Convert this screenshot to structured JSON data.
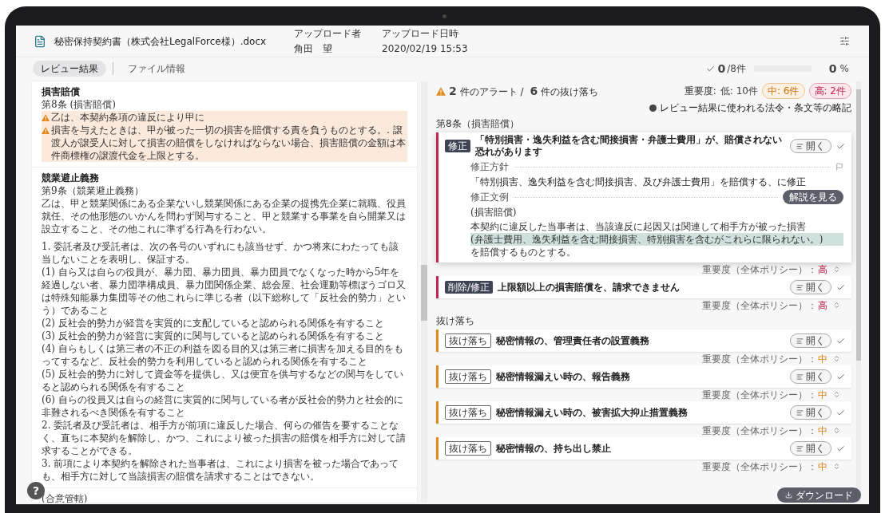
{
  "file": {
    "name": "秘密保持契約書（株式会社LegalForce様）.docx",
    "uploader_label": "アップロード者",
    "uploader": "角田　望",
    "date_label": "アップロード日時",
    "date": "2020/02/19 15:53"
  },
  "tabs": [
    {
      "label": "レビュー結果",
      "selected": true
    },
    {
      "label": "ファイル情報",
      "selected": false
    }
  ],
  "progress": {
    "done": "0",
    "total": "/8件",
    "level": 0,
    "percent": "0",
    "percent_unit": "%"
  },
  "document": {
    "sections": [
      {
        "title": "損害賠償",
        "article": "第8条 (損害賠償)",
        "paragraphs": [
          {
            "kind": "alert",
            "segments": [
              {
                "text": "乙は、本契約条項の違反により甲に"
              },
              {
                "text": "損害を与えたときは、甲が被った一切の損害を賠償する責を負うものとする。. 譲渡人が譲受人に対して損害の賠償をしなければならない場合、損害賠償の金額は本件商標権の譲渡代金を上限とする。"
              }
            ]
          }
        ]
      },
      {
        "title": "競業避止義務",
        "article": "第9条（競業避止義務）",
        "paragraphs": [
          {
            "kind": "plain",
            "text": "乙は、甲と競業関係にある企業ないし競業関係にある企業の提携先企業に就職、役員就任、その他形態のいかんを問わず関与すること、甲と競業する事業を自ら開業又は設立すること、その他これに準ずる行為を行わない。"
          },
          {
            "kind": "gap"
          },
          {
            "kind": "plain",
            "text": "1. 委託者及び受託者は、次の各号のいずれにも該当せず、かつ将来にわたっても該当しないことを表明し、保証する。"
          },
          {
            "kind": "plain",
            "text": "(1) 自ら又は自らの役員が、暴力団、暴力団員、暴力団員でなくなった時から5年を経過しない者、暴力団準構成員、暴力団関係企業、総会屋、社会運動等標ぼうゴロ又は特殊知能暴力集団等その他これらに準じる者（以下総称して「反社会的勢力」という）であること"
          },
          {
            "kind": "plain",
            "text": "(2) 反社会的勢力が経営を実質的に支配していると認められる関係を有すること"
          },
          {
            "kind": "plain",
            "text": "(3) 反社会的勢力が経営に実質的に関与していると認められる関係を有すること"
          },
          {
            "kind": "plain",
            "text": "(4) 自らもしくは第三者の不正の利益を図る目的又は第三者に損害を加える目的をもってするなど、反社会的勢力を利用していると認められる関係を有すること"
          },
          {
            "kind": "plain",
            "text": "(5) 反社会的勢力に対して資金等を提供し、又は便宜を供与するなどの関与をしていると認められる関係を有すること"
          },
          {
            "kind": "plain",
            "text": "(6) 自らの役員又は自らの経営に実質的に関与している者が反社会的勢力と社会的に非難されるべき関係を有すること"
          },
          {
            "kind": "plain",
            "text": "2. 委託者及び受託者は、相手方が前項に違反した場合、何らの催告を要することなく、直ちに本契約を解除し、かつ、これにより被った損害の賠償を相手方に対して請求することができる。"
          },
          {
            "kind": "plain",
            "text": "3. 前項により本契約を解除された当事者は、これにより損害を被った場合であっても、相手方に対して当該損害の賠償を請求することはできない。"
          }
        ]
      },
      {
        "article": "(合意管轄)"
      }
    ]
  },
  "review": {
    "summary": {
      "alerts": "2",
      "alerts_label": "件のアラート /",
      "omissions": "6",
      "omissions_label": "件の抜け落ち"
    },
    "severity": {
      "label": "重要度:",
      "low": "低: 10件",
      "medium": "中: 6件",
      "high": "高: 2件"
    },
    "notes_link": "レビュー結果に使われる法令・条文等の略記",
    "groups": [
      {
        "title": "第8条（損害賠償）",
        "items": [
          {
            "kind": "alert",
            "tag": "修正",
            "title": "「特別損害・逸失利益を含む間接損害・弁護士費用」が、賠償されない恐れがあります",
            "open": "開く",
            "expanded": true,
            "detail": {
              "policy_label": "修正方針",
              "policy": "「特別損害、逸失利益を含む間接損害、及び弁護士費用」を賠償する、に修正",
              "example_label": "修正文例",
              "explain_button": "解説を見る",
              "example_title": "(損害賠償)",
              "example_segments": [
                {
                  "text": "本契約に違反した当事者は、当該違反に起因又は関連して相手方が被った損害",
                  "highlighted": false
                },
                {
                  "text": "(弁護士費用、逸失利益を含む間接損害、特別損害を含むがこれらに限られない。)",
                  "highlighted": true
                },
                {
                  "text": "を賠償するものとする。",
                  "highlighted": false
                }
              ]
            },
            "severity": {
              "label": "重要度（全体ポリシー）：",
              "value": "高",
              "kind": "high"
            }
          },
          {
            "kind": "alert",
            "tag": "削除/修正",
            "title": "上限額以上の損害賠償を、請求できません",
            "open": "開く",
            "expanded": false,
            "severity": {
              "label": "重要度（全体ポリシー）：",
              "value": "高",
              "kind": "high"
            }
          }
        ]
      },
      {
        "title": "抜け落ち",
        "items": [
          {
            "kind": "omission",
            "tag": "抜け落ち",
            "title": "秘密情報の、管理責任者の設置義務",
            "open": "開く",
            "expanded": false,
            "severity": {
              "label": "重要度（全体ポリシー）：",
              "value": "中",
              "kind": "medium"
            }
          },
          {
            "kind": "omission",
            "tag": "抜け落ち",
            "title": "秘密情報漏えい時の、報告義務",
            "open": "開く",
            "expanded": false,
            "severity": {
              "label": "重要度（全体ポリシー）：",
              "value": "中",
              "kind": "medium"
            }
          },
          {
            "kind": "omission",
            "tag": "抜け落ち",
            "title": "秘密情報漏えい時の、被害拡大抑止措置義務",
            "open": "開く",
            "expanded": false,
            "severity": {
              "label": "重要度（全体ポリシー）：",
              "value": "中",
              "kind": "medium"
            }
          },
          {
            "kind": "omission",
            "tag": "抜け落ち",
            "title": "秘密情報の、持ち出し禁止",
            "open": "開く",
            "expanded": false,
            "severity": {
              "label": "重要度（全体ポリシー）：",
              "value": "中",
              "kind": "medium"
            }
          }
        ]
      }
    ]
  },
  "help_button": "?",
  "download_button": "ダウンロード"
}
